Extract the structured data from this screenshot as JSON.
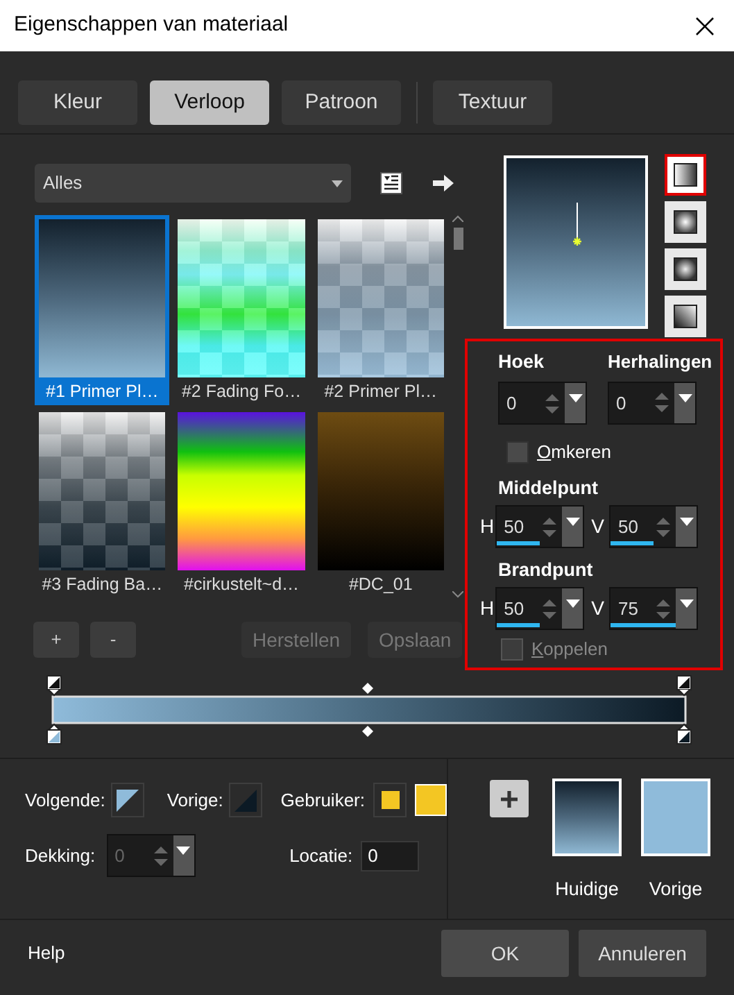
{
  "window": {
    "title": "Eigenschappen van materiaal"
  },
  "tabs": [
    {
      "label": "Kleur",
      "selected": false
    },
    {
      "label": "Verloop",
      "selected": true
    },
    {
      "label": "Patroon",
      "selected": false
    },
    {
      "label": "Textuur",
      "selected": false
    }
  ],
  "category": {
    "value": "Alles"
  },
  "gradients": [
    {
      "label": "#1 Primer Pl…",
      "selected": true
    },
    {
      "label": "#2 Fading Fo…",
      "selected": false
    },
    {
      "label": "#2 Primer Pl…",
      "selected": false
    },
    {
      "label": "#3 Fading Ba…",
      "selected": false
    },
    {
      "label": "#cirkustelt~d…",
      "selected": false
    },
    {
      "label": "#DC_01",
      "selected": false
    }
  ],
  "gradient_buttons": [
    {
      "label": "+"
    },
    {
      "label": "-"
    }
  ],
  "preset_buttons": [
    {
      "label": "Herstellen",
      "disabled": true
    },
    {
      "label": "Opslaan",
      "disabled": true
    }
  ],
  "gradient_styles": [
    {
      "kind": "linear",
      "selected": true
    },
    {
      "kind": "rectangular",
      "selected": false
    },
    {
      "kind": "sunburst",
      "selected": false
    },
    {
      "kind": "radial",
      "selected": false
    }
  ],
  "settings": {
    "angle": {
      "label": "Hoek",
      "value": "0"
    },
    "repeats": {
      "label": "Herhalingen",
      "value": "0"
    },
    "reverse": {
      "label": "Omkeren",
      "checked": false
    },
    "center": {
      "label": "Middelpunt",
      "fields": [
        {
          "axis": "H",
          "value": "50",
          "level": 0.5
        },
        {
          "axis": "V",
          "value": "50",
          "level": 0.5
        }
      ]
    },
    "focus": {
      "label": "Brandpunt",
      "fields": [
        {
          "axis": "H",
          "value": "50",
          "level": 0.5
        },
        {
          "axis": "V",
          "value": "75",
          "level": 0.75
        }
      ]
    },
    "link": {
      "label": "Koppelen",
      "checked": false,
      "disabled": true
    }
  },
  "stop_colors": [
    {
      "label": "Volgende:",
      "kind": "next"
    },
    {
      "label": "Vorige:",
      "kind": "previous"
    },
    {
      "label": "Gebruiker:",
      "kind": "user"
    }
  ],
  "opacity": {
    "label": "Dekking:",
    "value": "0",
    "disabled": true
  },
  "location": {
    "label": "Locatie:",
    "value": "0"
  },
  "swatches": [
    {
      "label": "Huidige",
      "kind": "gradient"
    },
    {
      "label": "Vorige",
      "kind": "solid"
    }
  ],
  "footer": {
    "help": "Help",
    "buttons": [
      {
        "label": "OK"
      },
      {
        "label": "Annuleren"
      }
    ]
  }
}
